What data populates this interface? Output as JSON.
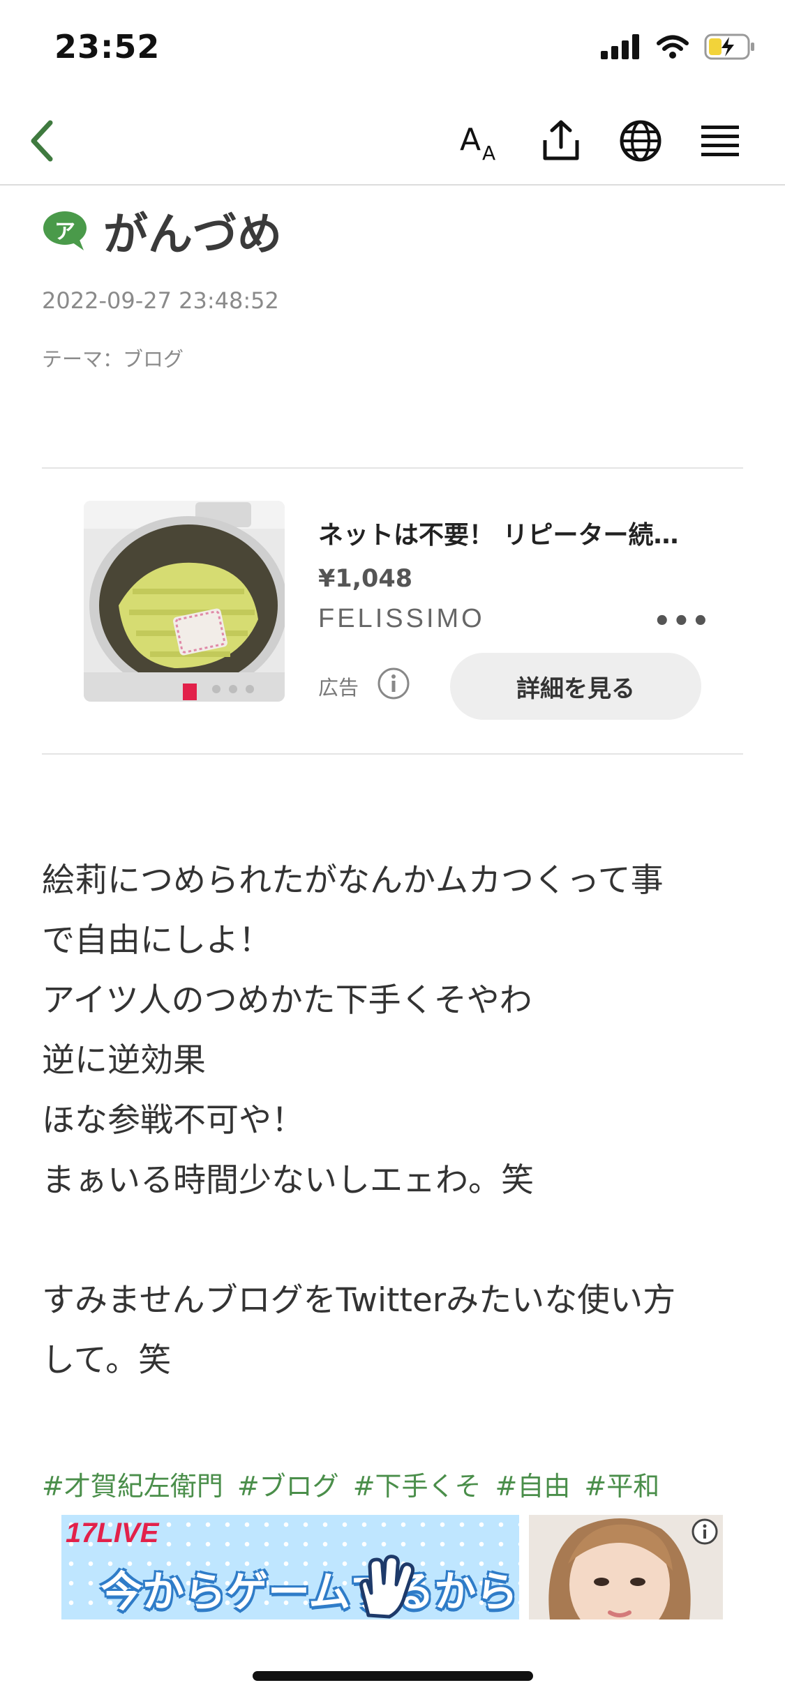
{
  "status_bar": {
    "time": "23:52",
    "icons": [
      "signal-icon",
      "wifi-icon",
      "battery-charging-icon"
    ]
  },
  "navbar": {
    "icons": [
      "back-chevron-icon",
      "font-size-icon",
      "share-icon",
      "globe-icon",
      "menu-icon"
    ],
    "accent_color": "#3f7a3f"
  },
  "post": {
    "author_badge_char": "ア",
    "author_name": "がんづめ",
    "date": "2022-09-27 23:48:52",
    "theme": "テーマ：ブログ",
    "body_lines": [
      "絵莉につめられたがなんかムカつくって事",
      "で自由にしよ！",
      "アイツ人のつめかた下手くそやわ",
      "逆に逆効果",
      "ほな参戦不可や！",
      "まぁいる時間少ないしエェわ。笑",
      "",
      "すみませんブログをTwitterみたいな使い方",
      "して。笑"
    ],
    "hashtags": [
      "#才賀紀左衛門",
      "#ブログ",
      "#下手くそ",
      "#自由",
      "#平和"
    ],
    "hashtag_color": "#4a8e4a"
  },
  "ad": {
    "title": "ネットは不要！ リピーター続出の…",
    "price": "¥1,048",
    "brand": "FELISSIMO",
    "label": "広告",
    "cta": "詳細を見る",
    "more": "•••"
  },
  "bottom_ad": {
    "brand": "17LIVE",
    "text": "今からゲームするから"
  }
}
